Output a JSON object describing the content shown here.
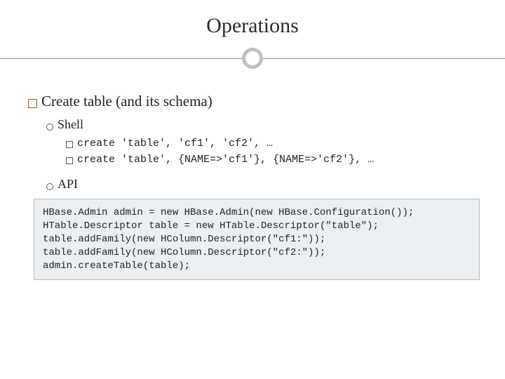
{
  "title": "Operations",
  "section": {
    "heading": "Create table (and its schema)",
    "shell": {
      "label": "Shell",
      "lines": [
        "create 'table', 'cf1', 'cf2', …",
        "create 'table', {NAME=>'cf1'}, {NAME=>'cf2'}, …"
      ]
    },
    "api": {
      "label": "API",
      "code": "HBase.Admin admin = new HBase.Admin(new HBase.Configuration());\nHTable.Descriptor table = new HTable.Descriptor(\"table\");\ntable.addFamily(new HColumn.Descriptor(\"cf1:\"));\ntable.addFamily(new HColumn.Descriptor(\"cf2:\"));\nadmin.createTable(table);"
    }
  }
}
